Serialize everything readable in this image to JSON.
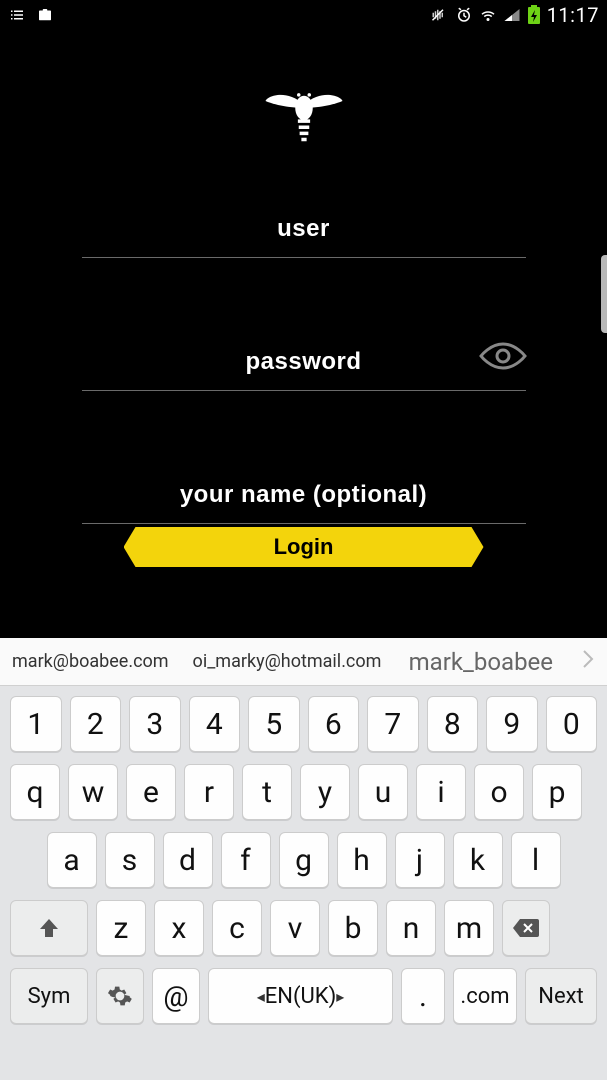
{
  "status_bar": {
    "time": "11:17"
  },
  "app": {
    "placeholders": {
      "user": "user",
      "password": "password",
      "name": "your name (optional)"
    },
    "login_label": "Login"
  },
  "keyboard": {
    "suggestions": [
      "mark@boabee.com",
      "oi_marky@hotmail.com",
      "mark_boabee"
    ],
    "row1": [
      "1",
      "2",
      "3",
      "4",
      "5",
      "6",
      "7",
      "8",
      "9",
      "0"
    ],
    "row2": [
      "q",
      "w",
      "e",
      "r",
      "t",
      "y",
      "u",
      "i",
      "o",
      "p"
    ],
    "row3": [
      "a",
      "s",
      "d",
      "f",
      "g",
      "h",
      "j",
      "k",
      "l"
    ],
    "row4_letters": [
      "z",
      "x",
      "c",
      "v",
      "b",
      "n",
      "m"
    ],
    "sym": "Sym",
    "at": "@",
    "space": "EN(UK)",
    "dot": ".",
    "com": ".com",
    "next": "Next"
  }
}
